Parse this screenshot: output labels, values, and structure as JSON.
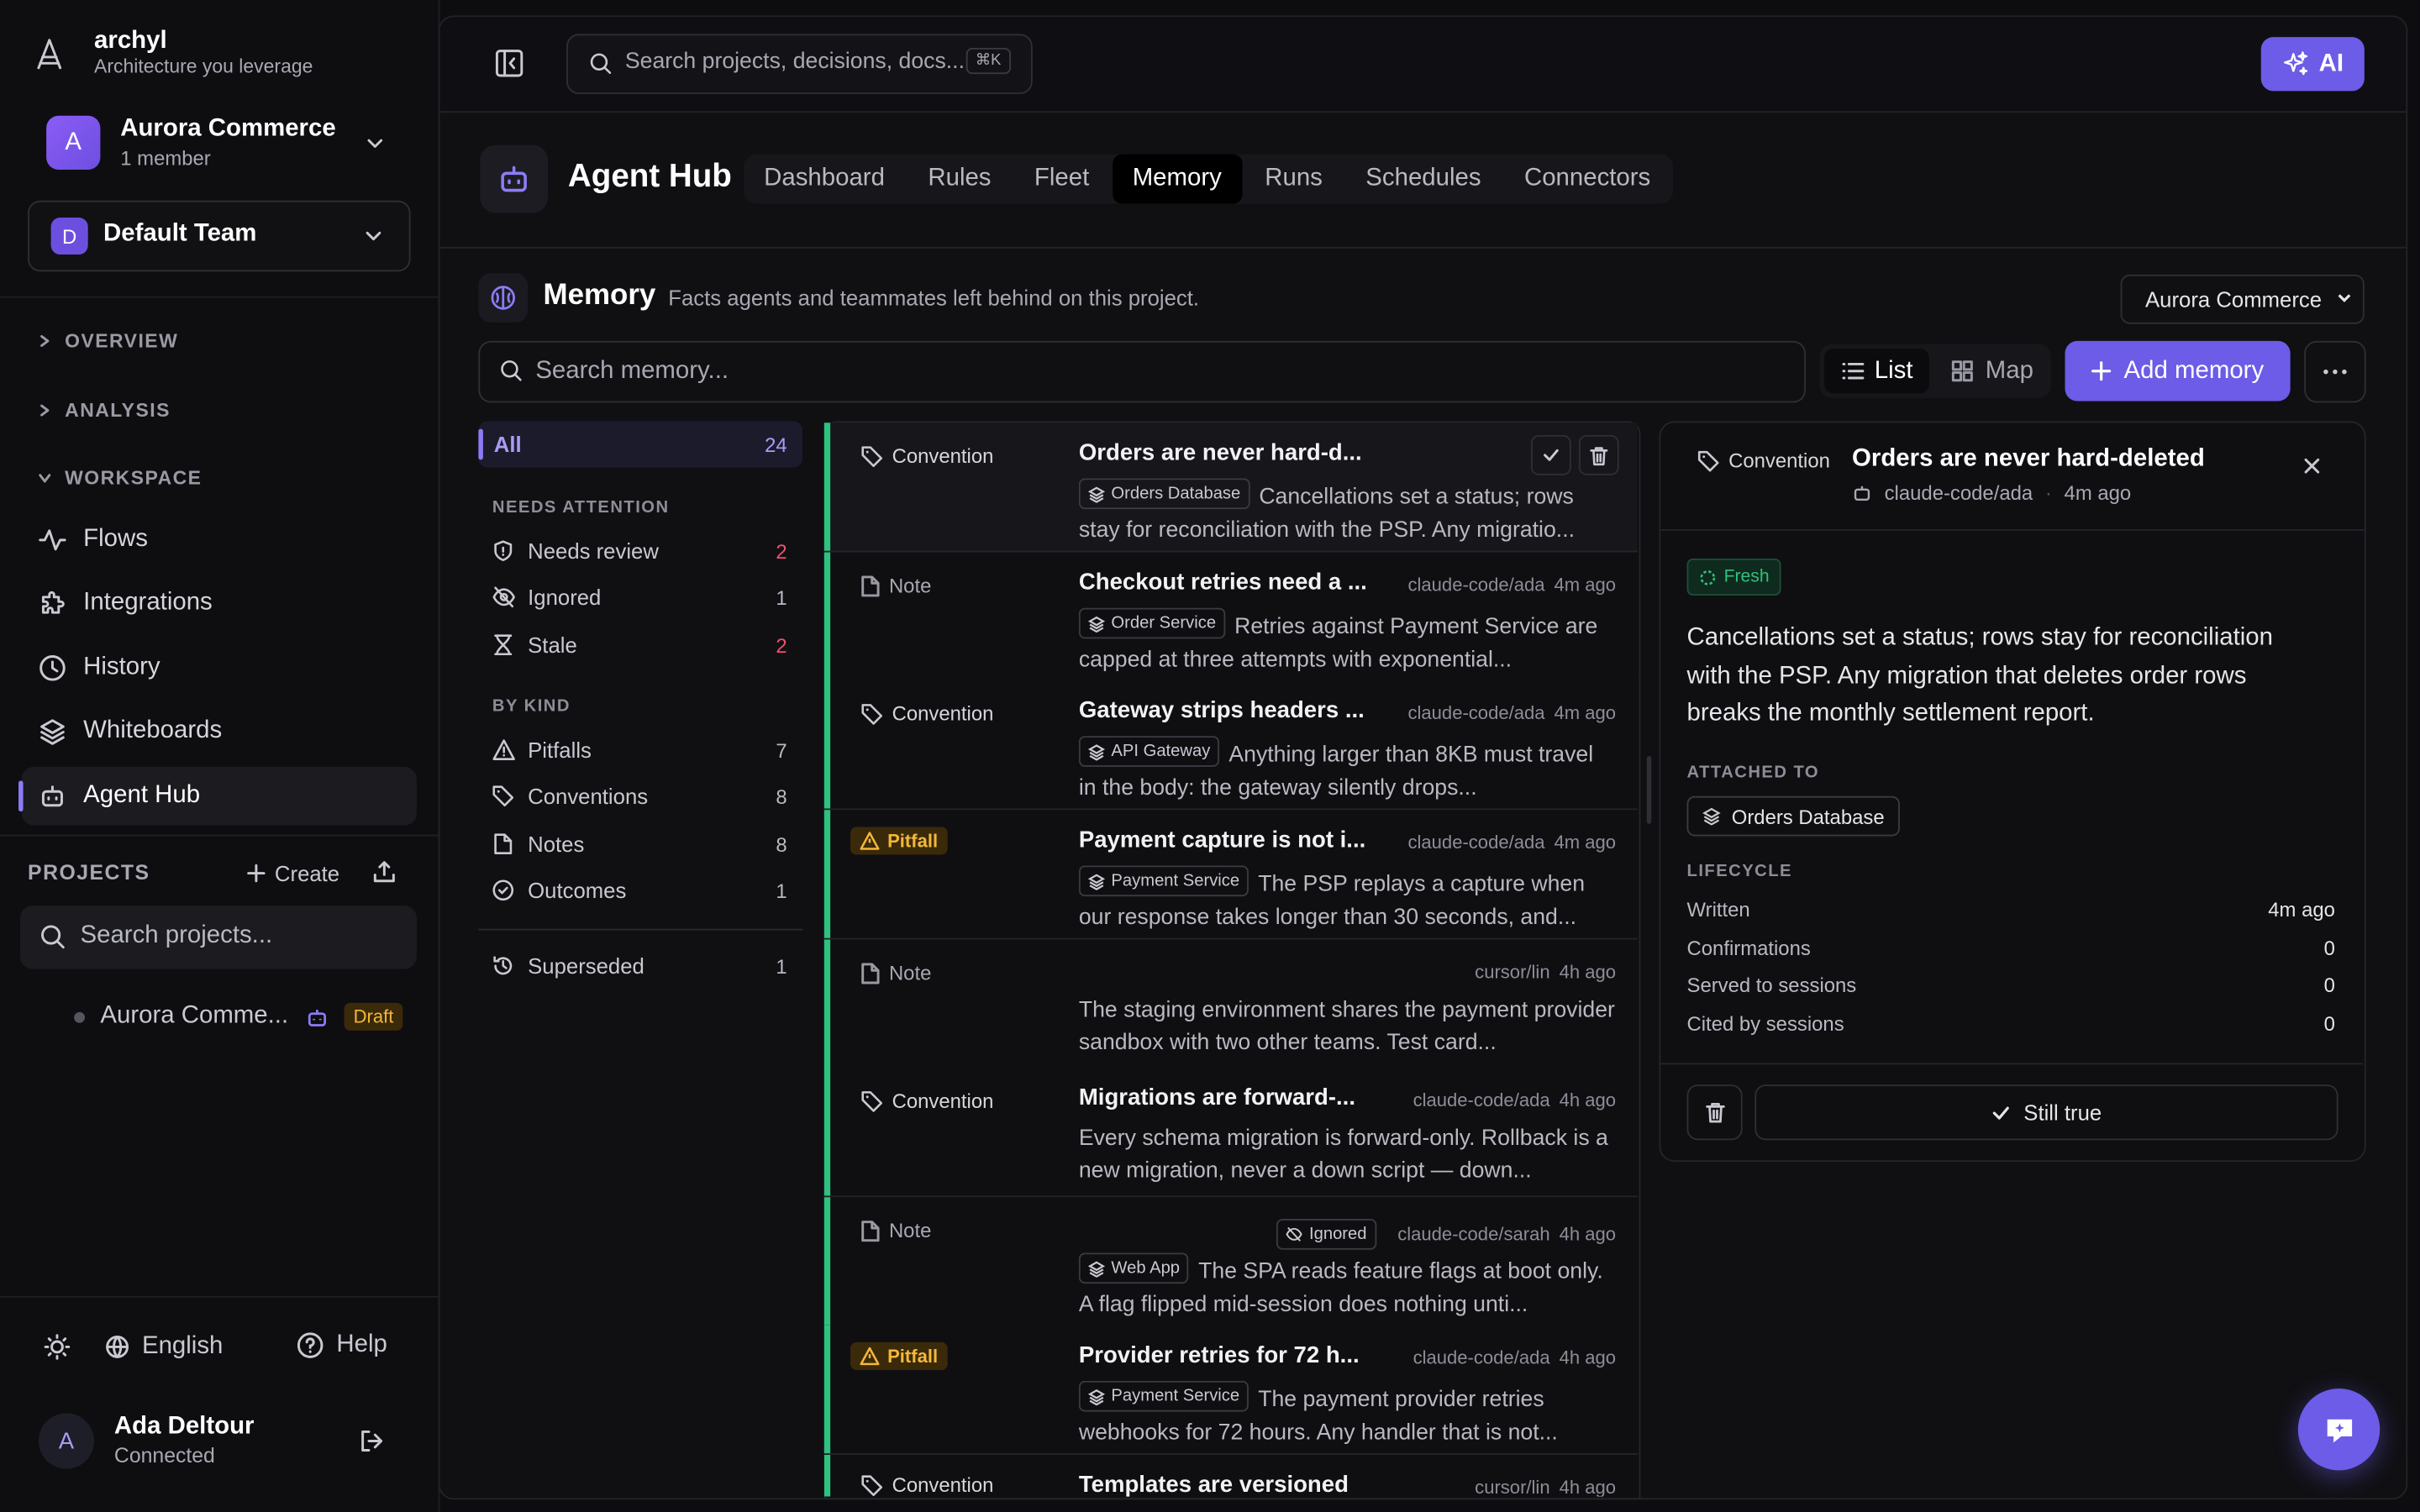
{
  "app": {
    "name": "archyl",
    "tagline": "Architecture you leverage"
  },
  "org": {
    "name": "Aurora Commerce",
    "members": "1 member",
    "initial": "A"
  },
  "team": {
    "name": "Default Team",
    "initial": "D"
  },
  "sidebar": {
    "sections": {
      "overview": "OVERVIEW",
      "analysis": "ANALYSIS",
      "workspace": "WORKSPACE"
    },
    "items": [
      {
        "label": "Flows",
        "icon": "activity-icon"
      },
      {
        "label": "Integrations",
        "icon": "puzzle-icon"
      },
      {
        "label": "History",
        "icon": "clock-icon"
      },
      {
        "label": "Whiteboards",
        "icon": "layers-icon"
      },
      {
        "label": "Agent Hub",
        "icon": "bot-icon",
        "active": true
      }
    ],
    "projects_label": "PROJECTS",
    "create_label": "Create",
    "search_placeholder": "Search projects...",
    "project": {
      "name": "Aurora Comme...",
      "badge": "Draft"
    },
    "footer": {
      "language": "English",
      "help": "Help"
    },
    "user": {
      "name": "Ada Deltour",
      "status": "Connected",
      "initial": "A"
    }
  },
  "topbar": {
    "search_placeholder": "Search projects, decisions, docs...",
    "shortcut": "⌘K",
    "ai_label": "AI"
  },
  "hub": {
    "title": "Agent Hub",
    "tabs": [
      "Dashboard",
      "Rules",
      "Fleet",
      "Memory",
      "Runs",
      "Schedules",
      "Connectors"
    ],
    "active_tab": "Memory"
  },
  "memory": {
    "title": "Memory",
    "subtitle": "Facts agents and teammates left behind on this project.",
    "project_select": "Aurora Commerce",
    "search_placeholder": "Search memory...",
    "view_list": "List",
    "view_map": "Map",
    "add_label": "Add memory"
  },
  "filters": {
    "all": {
      "label": "All",
      "count": "24"
    },
    "needs_attention_label": "NEEDS ATTENTION",
    "attention": [
      {
        "label": "Needs review",
        "count": "2",
        "icon": "shield-icon"
      },
      {
        "label": "Ignored",
        "count": "1",
        "icon": "eye-off-icon"
      },
      {
        "label": "Stale",
        "count": "2",
        "icon": "hourglass-icon"
      }
    ],
    "by_kind_label": "BY KIND",
    "kinds": [
      {
        "label": "Pitfalls",
        "count": "7",
        "icon": "warning-icon"
      },
      {
        "label": "Conventions",
        "count": "8",
        "icon": "tag-icon"
      },
      {
        "label": "Notes",
        "count": "8",
        "icon": "file-icon"
      },
      {
        "label": "Outcomes",
        "count": "1",
        "icon": "check-circle-icon"
      }
    ],
    "superseded": {
      "label": "Superseded",
      "count": "1"
    }
  },
  "cards": [
    {
      "kind": "Convention",
      "title": "Orders are never hard-d...",
      "author": "",
      "time": "",
      "pill": "Orders Database",
      "body": "Cancellations set a status; rows stay for reconciliation with the PSP. Any migratio..."
    },
    {
      "kind": "Note",
      "title": "Checkout retries need a ...",
      "author": "claude-code/ada",
      "time": "4m ago",
      "pill": "Order Service",
      "body": "Retries against Payment Service are capped at three attempts with exponential..."
    },
    {
      "kind": "Convention",
      "title": "Gateway strips headers ...",
      "author": "claude-code/ada",
      "time": "4m ago",
      "pill": "API Gateway",
      "body": "Anything larger than 8KB must travel in the body: the gateway silently drops..."
    },
    {
      "kind": "Pitfall",
      "title": "Payment capture is not i...",
      "author": "claude-code/ada",
      "time": "4m ago",
      "pill": "Payment Service",
      "body": "The PSP replays a capture when our response takes longer than 30 seconds, and..."
    },
    {
      "kind": "Note",
      "title": "",
      "author": "cursor/lin",
      "time": "4h ago",
      "pill": "",
      "body": "The staging environment shares the payment provider sandbox with two other teams. Test card..."
    },
    {
      "kind": "Convention",
      "title": "Migrations are forward-...",
      "author": "claude-code/ada",
      "time": "4h ago",
      "pill": "",
      "body": "Every schema migration is forward-only. Rollback is a new migration, never a down script — down..."
    },
    {
      "kind": "Note",
      "title": "",
      "author": "claude-code/sarah",
      "time": "4h ago",
      "pill": "Web App",
      "badge": "Ignored",
      "body": "The SPA reads feature flags at boot only. A flag flipped mid-session does nothing unti..."
    },
    {
      "kind": "Pitfall",
      "title": "Provider retries for 72 h...",
      "author": "claude-code/ada",
      "time": "4h ago",
      "pill": "Payment Service",
      "body": "The payment provider retries webhooks for 72 hours. Any handler that is not..."
    },
    {
      "kind": "Convention",
      "title": "Templates are versioned",
      "author": "cursor/lin",
      "time": "4h ago",
      "pill": "",
      "body": ""
    }
  ],
  "detail": {
    "kind": "Convention",
    "title": "Orders are never hard-deleted",
    "author": "claude-code/ada",
    "time": "4m ago",
    "status": "Fresh",
    "body": "Cancellations set a status; rows stay for reconciliation with the PSP. Any migration that deletes order rows breaks the monthly settlement report.",
    "attached_label": "ATTACHED TO",
    "attached": "Orders Database",
    "lifecycle_label": "LIFECYCLE",
    "lifecycle": [
      {
        "label": "Written",
        "value": "4m ago"
      },
      {
        "label": "Confirmations",
        "value": "0"
      },
      {
        "label": "Served to sessions",
        "value": "0"
      },
      {
        "label": "Cited by sessions",
        "value": "0"
      }
    ],
    "confirm_label": "Still true"
  },
  "colors": {
    "accent": "#6c5ce7",
    "fresh": "#2ec27e",
    "pitfall": "#f4b73a",
    "attention": "#f0506e"
  }
}
